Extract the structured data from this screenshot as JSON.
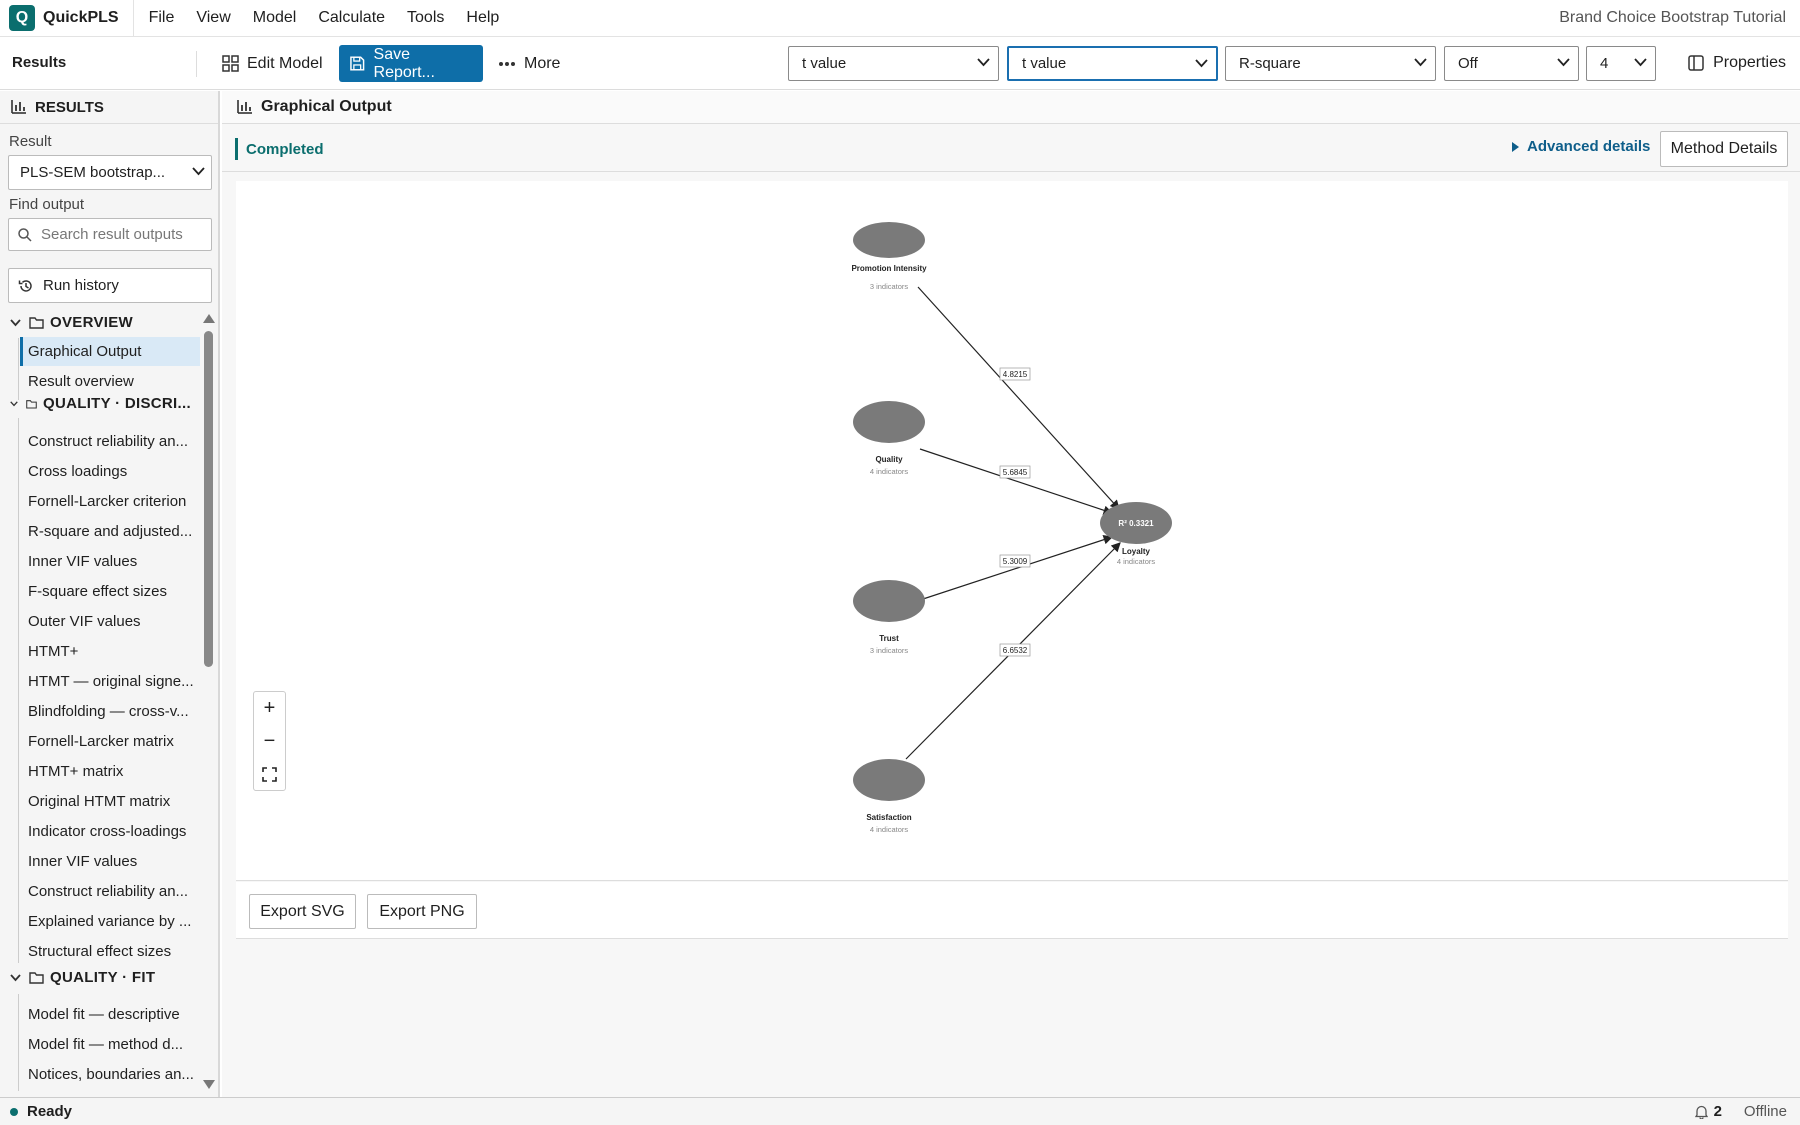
{
  "app": {
    "logo_letter": "Q",
    "name": "QuickPLS",
    "title": "Brand Choice Bootstrap Tutorial"
  },
  "menu": [
    "File",
    "View",
    "Model",
    "Calculate",
    "Tools",
    "Help"
  ],
  "toolbar": {
    "section": "Results",
    "edit_model": "Edit Model",
    "save_report": "Save Report...",
    "more": "More",
    "select_1": "t value",
    "select_2": "t value",
    "select_3": "R-square",
    "select_4": "Off",
    "select_5": "4",
    "properties": "Properties"
  },
  "sidebar": {
    "title": "RESULTS",
    "result_label": "Result",
    "result_value": "PLS-SEM bootstrap...",
    "find_label": "Find output",
    "search_placeholder": "Search result outputs",
    "run_history": "Run history",
    "groups": {
      "overview": "OVERVIEW",
      "quality_disc": "QUALITY · DISCRI...",
      "quality_fit": "QUALITY · FIT"
    },
    "overview_items": [
      "Graphical Output",
      "Result overview"
    ],
    "disc_items": [
      "Construct reliability an...",
      "Cross loadings",
      "Fornell-Larcker criterion",
      "R-square and adjusted...",
      "Inner VIF values",
      "F-square effect sizes",
      "Outer VIF values",
      "HTMT+",
      "HTMT — original signe...",
      "Blindfolding — cross-v...",
      "Fornell-Larcker matrix",
      "HTMT+ matrix",
      "Original HTMT matrix",
      "Indicator cross-loadings",
      "Inner VIF values",
      "Construct reliability an...",
      "Explained variance by ...",
      "Structural effect sizes"
    ],
    "fit_items": [
      "Model fit — descriptive",
      "Model fit — method d...",
      "Notices, boundaries an..."
    ]
  },
  "main": {
    "title": "Graphical Output",
    "status": "Completed",
    "advanced": "Advanced details",
    "method_details": "Method Details",
    "export_svg": "Export SVG",
    "export_png": "Export PNG",
    "zoom_in": "+",
    "zoom_out": "−"
  },
  "diagram": {
    "constructs": [
      {
        "name": "Promotion Intensity",
        "indicators": "3 indicators"
      },
      {
        "name": "Quality",
        "indicators": "4 indicators"
      },
      {
        "name": "Trust",
        "indicators": "3 indicators"
      },
      {
        "name": "Satisfaction",
        "indicators": "4 indicators"
      },
      {
        "name": "Loyalty",
        "indicators": "4 indicators",
        "r2_label": "R² 0.3321"
      }
    ],
    "paths": [
      {
        "from": "Promotion Intensity",
        "to": "Loyalty",
        "t_value": "4.8215"
      },
      {
        "from": "Quality",
        "to": "Loyalty",
        "t_value": "5.6845"
      },
      {
        "from": "Trust",
        "to": "Loyalty",
        "t_value": "5.3009"
      },
      {
        "from": "Satisfaction",
        "to": "Loyalty",
        "t_value": "6.6532"
      }
    ]
  },
  "statusbar": {
    "ready": "Ready",
    "notifications": "2",
    "connection": "Offline"
  },
  "colors": {
    "brand": "#0b6e6e",
    "primary_button": "#0e6ea8",
    "construct_fill": "#7a7a7a"
  }
}
